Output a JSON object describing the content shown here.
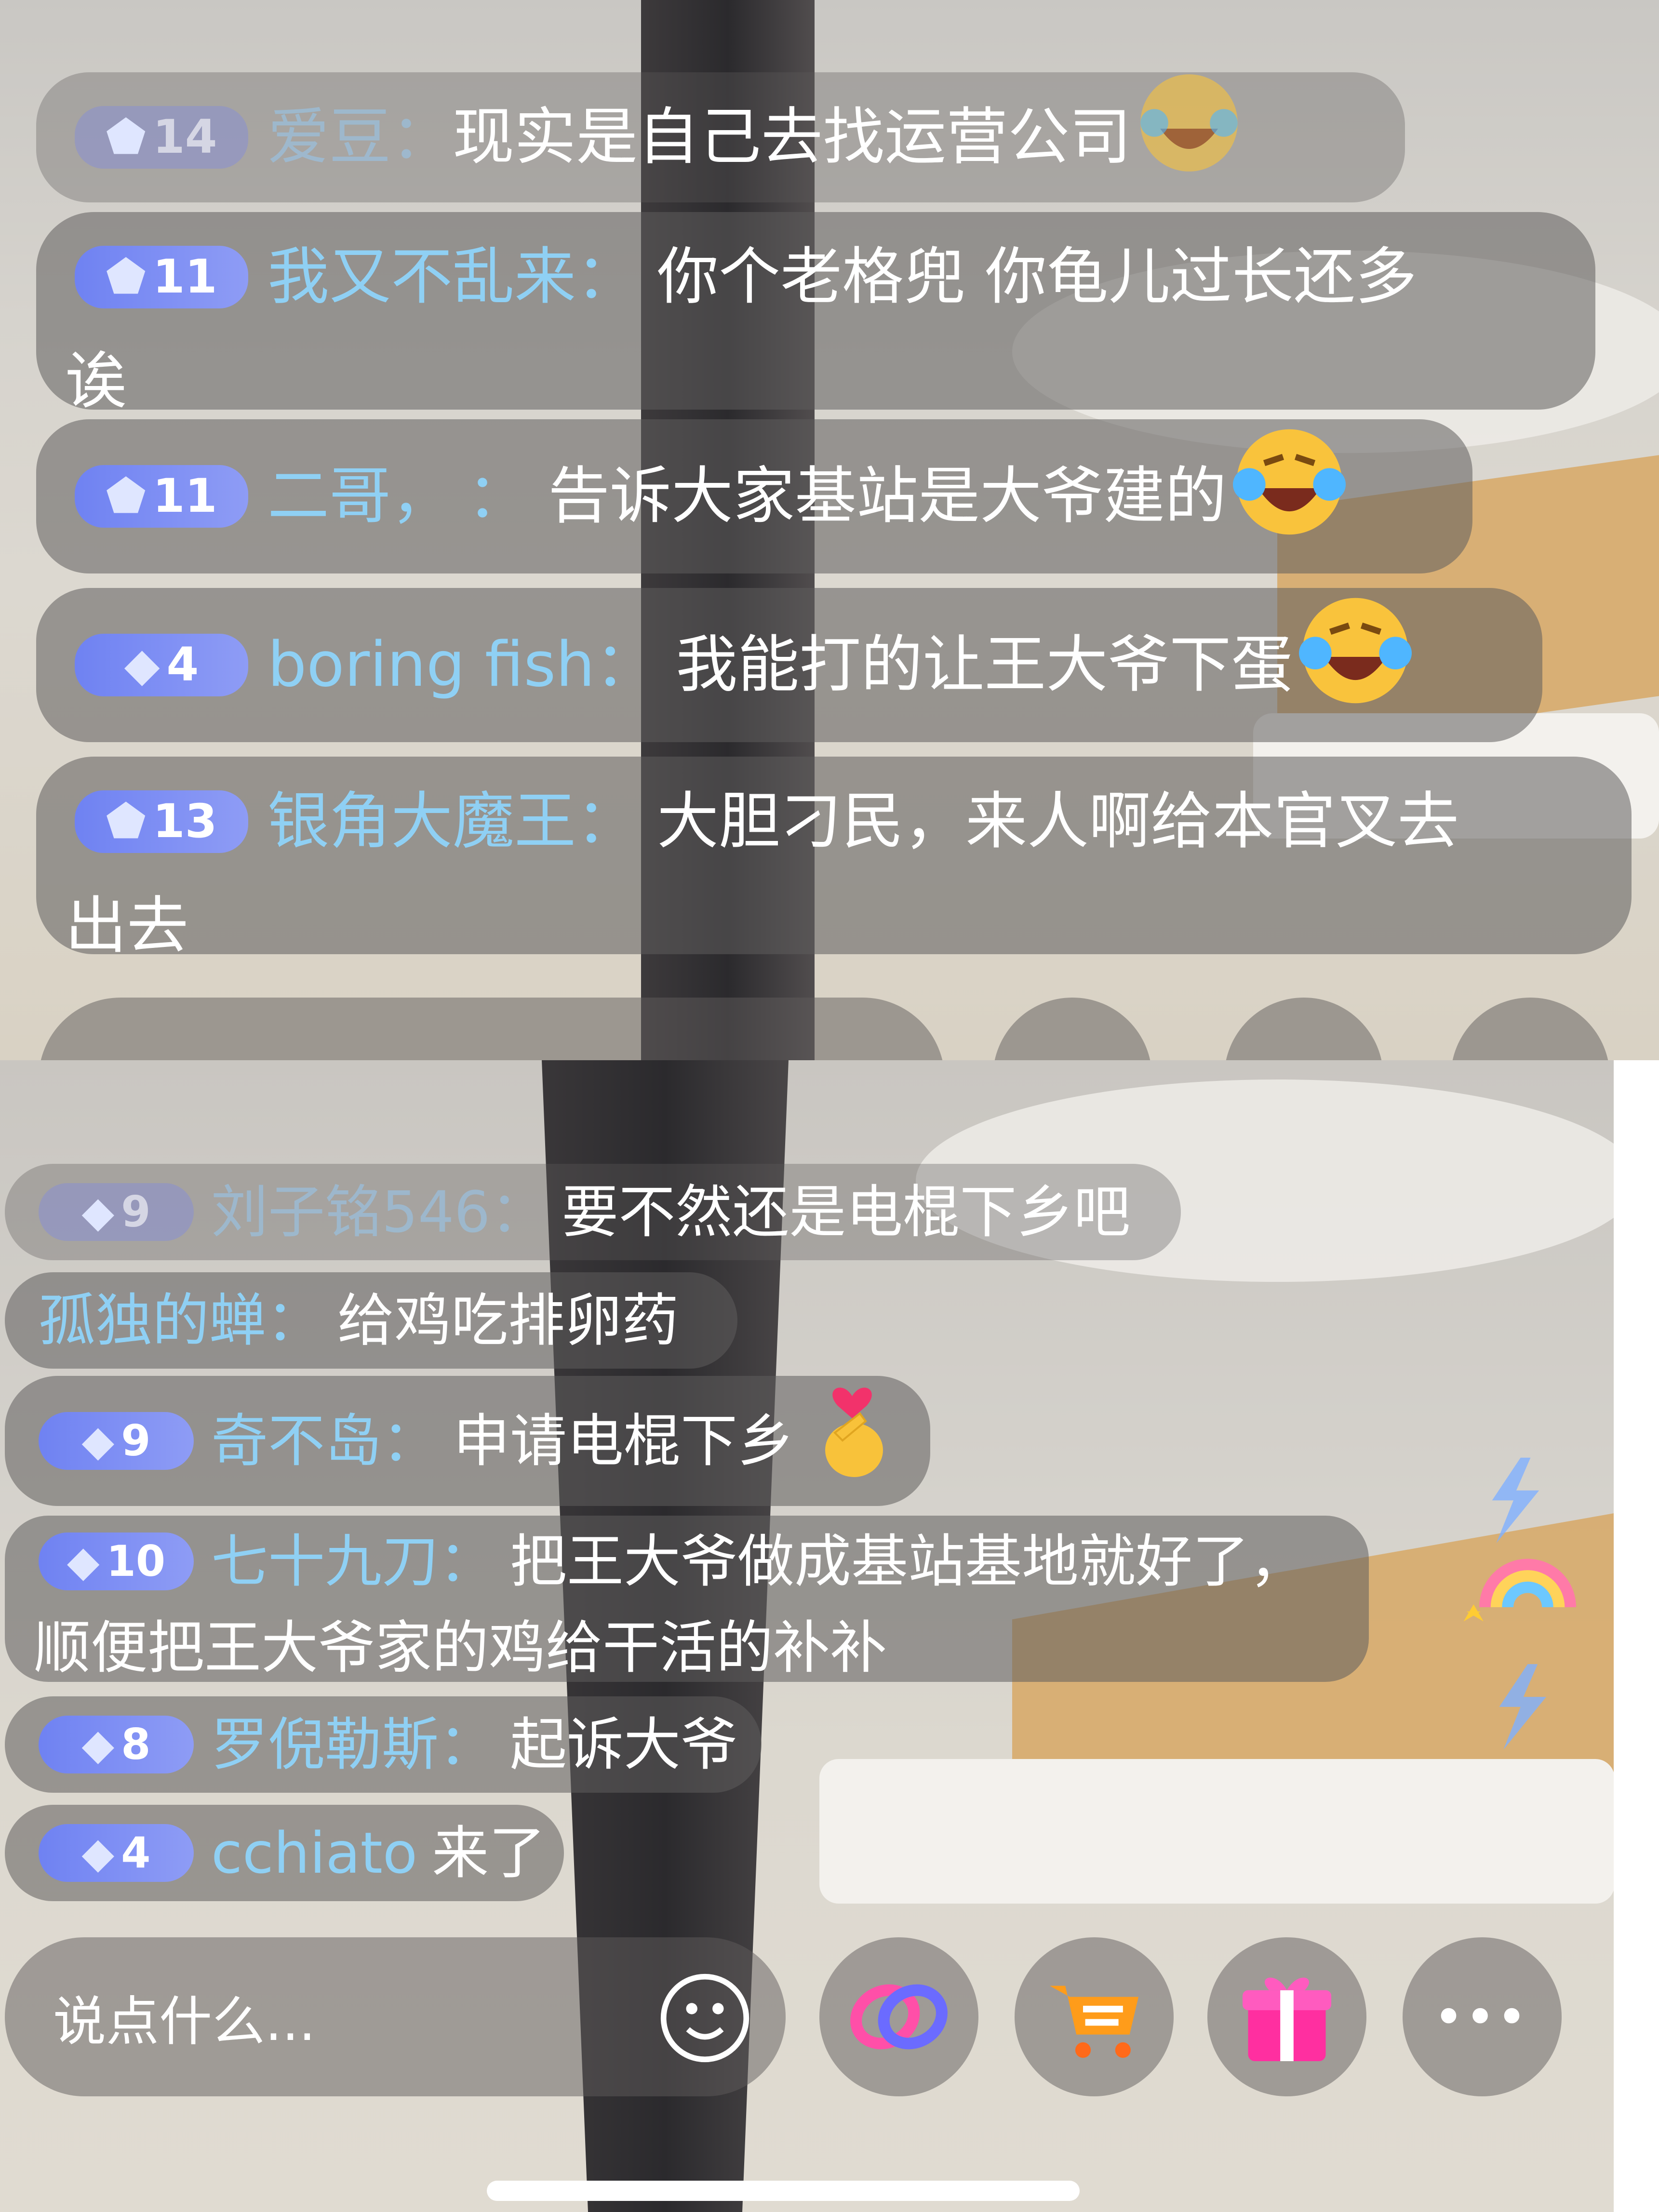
{
  "top_panel": {
    "messages": [
      {
        "level": "14",
        "user": "爱豆",
        "text": "现实是自己去找运营公司",
        "faded": true,
        "emoji": "laugh-cry"
      },
      {
        "level": "11",
        "user": "我又不乱来",
        "text": "你个老格兜  你龟儿过长还多",
        "text2": "诶",
        "faded": false
      },
      {
        "level": "11",
        "user": "二哥，",
        "text": "告诉大家基站是大爷建的",
        "faded": false,
        "emoji": "laugh-cry"
      },
      {
        "level": "4",
        "user": "boring fish",
        "text": "我能打的让王大爷下蛋",
        "faded": false,
        "emoji": "laugh-cry"
      },
      {
        "level": "13",
        "user": "银角大魔王",
        "text": "大胆刁民，来人啊给本官叉去",
        "text2": "出去",
        "faded": false
      }
    ]
  },
  "bottom_panel": {
    "messages": [
      {
        "level": "9",
        "user": "刘子铭546",
        "text": "要不然还是电棍下乡吧",
        "faded": true
      },
      {
        "level": "",
        "user": "孤独的蝉",
        "text": "给鸡吃排卵药",
        "faded": false
      },
      {
        "level": "9",
        "user": "奇不岛",
        "text": "申请电棍下乡",
        "faded": false,
        "emoji": "finger-heart"
      },
      {
        "level": "10",
        "user": "七十九刀",
        "text": "把王大爷做成基站基地就好了，",
        "text2": "顺便把王大爷家的鸡给干活的补补",
        "faded": false
      },
      {
        "level": "8",
        "user": "罗倪勒斯",
        "text": "起诉大爷",
        "faded": false
      },
      {
        "level": "4",
        "user": "cchiato",
        "text": "来了",
        "faded": false,
        "join": true
      }
    ],
    "input_placeholder": "说点什么...",
    "buttons": [
      "emoji-icon",
      "link-icon",
      "cart-icon",
      "gift-icon",
      "more-icon"
    ]
  },
  "colors": {
    "username": "#8fd0f4",
    "badge": "#7b8cf3",
    "bubble": "rgba(95,92,92,.55)"
  },
  "separator": "：",
  "more_glyph": "•••"
}
